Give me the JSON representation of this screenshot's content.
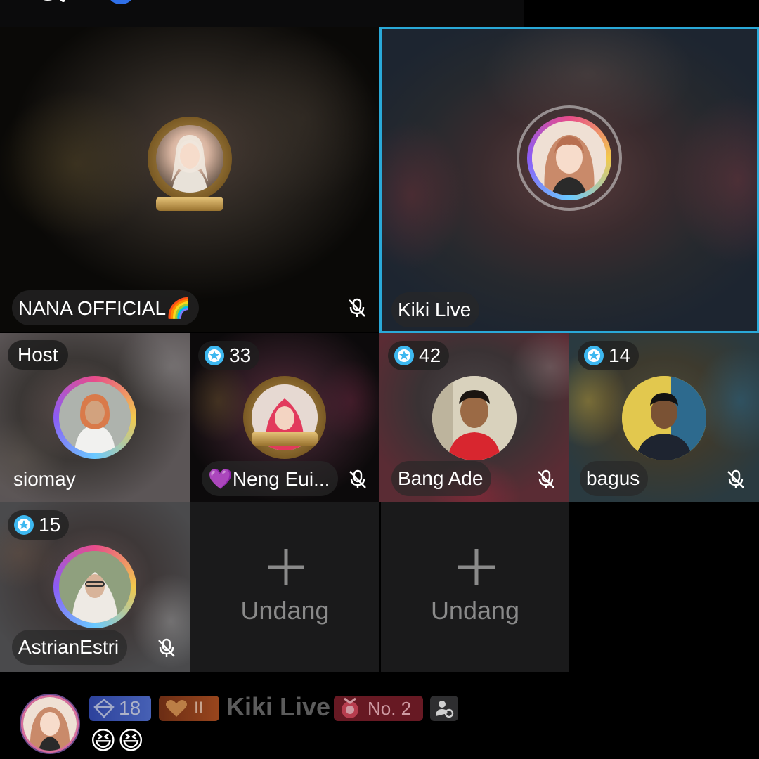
{
  "host_tiles": [
    {
      "name": "NANA OFFICIAL🌈",
      "muted": true
    },
    {
      "name": "Kiki Live",
      "muted": false,
      "speaking": true
    }
  ],
  "guest_tiles": [
    {
      "name": "siomay",
      "role": "Host",
      "badge": null,
      "muted": false
    },
    {
      "name": "💜Neng Eui...",
      "badge": "33",
      "muted": true
    },
    {
      "name": "Bang Ade",
      "badge": "42",
      "muted": true
    },
    {
      "name": "bagus",
      "badge": "14",
      "muted": true
    },
    {
      "name": "AstrianEstri",
      "badge": "15",
      "muted": true
    }
  ],
  "invite_slots": [
    {
      "label": "Undang"
    },
    {
      "label": "Undang"
    }
  ],
  "chat": {
    "level": "18",
    "fan_badge": "II",
    "user": "Kiki Live",
    "rank": "No. 2",
    "message": "😆😆"
  },
  "colors": {
    "speaking_border": "#2aa9d8",
    "invite_bg": "#1a1a1b",
    "badge_star": "#3db8f0"
  },
  "icons": [
    "search-icon",
    "mic-off-icon",
    "star-badge-icon",
    "plus-icon",
    "diamond-icon",
    "heart-icon",
    "medal-icon",
    "profile-icon"
  ]
}
